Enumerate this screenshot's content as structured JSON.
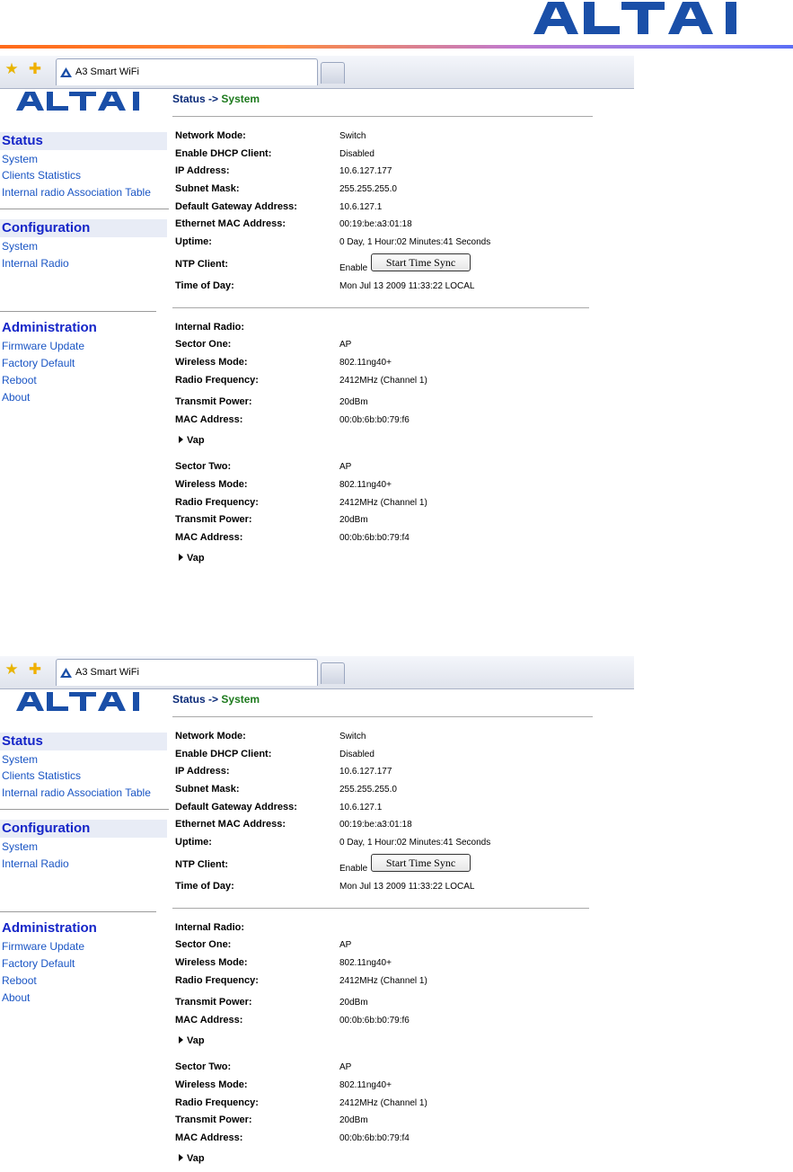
{
  "document": {
    "brand_logo": "ALTAI"
  },
  "screens": [
    {
      "browser": {
        "tab_title": "A3 Smart WiFi"
      },
      "brand": "ALTAI",
      "breadcrumb": {
        "section": "Status",
        "separator": "->",
        "page": "System"
      },
      "sidebar": {
        "status": {
          "title": "Status",
          "items": [
            "System",
            "Clients Statistics",
            "Internal radio Association Table"
          ]
        },
        "configuration": {
          "title": "Configuration",
          "items": [
            "System",
            "Internal Radio"
          ]
        },
        "administration": {
          "title": "Administration",
          "items": [
            "Firmware Update",
            "Factory Default",
            "Reboot",
            "About"
          ]
        }
      },
      "system": {
        "network_mode": {
          "label": "Network Mode:",
          "value": "Switch"
        },
        "dhcp_client": {
          "label": "Enable DHCP Client:",
          "value": "Disabled"
        },
        "ip_address": {
          "label": "IP Address:",
          "value": "10.6.127.177"
        },
        "subnet_mask": {
          "label": "Subnet Mask:",
          "value": "255.255.255.0"
        },
        "gateway": {
          "label": "Default Gateway Address:",
          "value": "10.6.127.1"
        },
        "ethernet_mac": {
          "label": "Ethernet MAC Address:",
          "value": "00:19:be:a3:01:18"
        },
        "uptime": {
          "label": "Uptime:",
          "value": "0 Day, 1 Hour:02 Minutes:41 Seconds"
        },
        "ntp_client": {
          "label": "NTP Client:",
          "value": "Enable",
          "button": "Start Time Sync"
        },
        "time_of_day": {
          "label": "Time of Day:",
          "value": "Mon Jul 13 2009 11:33:22 LOCAL"
        }
      },
      "radio": {
        "title": "Internal Radio:",
        "sector_one": {
          "sector": {
            "label": "Sector One:",
            "value": "AP"
          },
          "wireless_mode": {
            "label": "Wireless Mode:",
            "value": "802.11ng40+"
          },
          "frequency": {
            "label": "Radio Frequency:",
            "value": "2412MHz (Channel 1)"
          },
          "tx_power": {
            "label": "Transmit Power:",
            "value": "20dBm"
          },
          "mac": {
            "label": "MAC Address:",
            "value": "00:0b:6b:b0:79:f6"
          },
          "vap": "Vap"
        },
        "sector_two": {
          "sector": {
            "label": "Sector Two:",
            "value": "AP"
          },
          "wireless_mode": {
            "label": "Wireless Mode:",
            "value": "802.11ng40+"
          },
          "frequency": {
            "label": "Radio Frequency:",
            "value": "2412MHz (Channel 1)"
          },
          "tx_power": {
            "label": "Transmit Power:",
            "value": "20dBm"
          },
          "mac": {
            "label": "MAC Address:",
            "value": "00:0b:6b:b0:79:f4"
          },
          "vap": "Vap"
        }
      }
    },
    {
      "browser": {
        "tab_title": "A3 Smart WiFi"
      },
      "brand": "ALTAI",
      "breadcrumb": {
        "section": "Status",
        "separator": "->",
        "page": "System"
      },
      "sidebar": {
        "status": {
          "title": "Status",
          "items": [
            "System",
            "Clients Statistics",
            "Internal radio Association Table"
          ]
        },
        "configuration": {
          "title": "Configuration",
          "items": [
            "System",
            "Internal Radio"
          ]
        },
        "administration": {
          "title": "Administration",
          "items": [
            "Firmware Update",
            "Factory Default",
            "Reboot",
            "About"
          ]
        }
      },
      "system": {
        "network_mode": {
          "label": "Network Mode:",
          "value": "Switch"
        },
        "dhcp_client": {
          "label": "Enable DHCP Client:",
          "value": "Disabled"
        },
        "ip_address": {
          "label": "IP Address:",
          "value": "10.6.127.177"
        },
        "subnet_mask": {
          "label": "Subnet Mask:",
          "value": "255.255.255.0"
        },
        "gateway": {
          "label": "Default Gateway Address:",
          "value": "10.6.127.1"
        },
        "ethernet_mac": {
          "label": "Ethernet MAC Address:",
          "value": "00:19:be:a3:01:18"
        },
        "uptime": {
          "label": "Uptime:",
          "value": "0 Day, 1 Hour:02 Minutes:41 Seconds"
        },
        "ntp_client": {
          "label": "NTP Client:",
          "value": "Enable",
          "button": "Start Time Sync"
        },
        "time_of_day": {
          "label": "Time of Day:",
          "value": "Mon Jul 13 2009 11:33:22 LOCAL"
        }
      },
      "radio": {
        "title": "Internal Radio:",
        "sector_one": {
          "sector": {
            "label": "Sector One:",
            "value": "AP"
          },
          "wireless_mode": {
            "label": "Wireless Mode:",
            "value": "802.11ng40+"
          },
          "frequency": {
            "label": "Radio Frequency:",
            "value": "2412MHz (Channel 1)"
          },
          "tx_power": {
            "label": "Transmit Power:",
            "value": "20dBm"
          },
          "mac": {
            "label": "MAC Address:",
            "value": "00:0b:6b:b0:79:f6"
          },
          "vap": "Vap"
        },
        "sector_two": {
          "sector": {
            "label": "Sector Two:",
            "value": "AP"
          },
          "wireless_mode": {
            "label": "Wireless Mode:",
            "value": "802.11ng40+"
          },
          "frequency": {
            "label": "Radio Frequency:",
            "value": "2412MHz (Channel 1)"
          },
          "tx_power": {
            "label": "Transmit Power:",
            "value": "20dBm"
          },
          "mac": {
            "label": "MAC Address:",
            "value": "00:0b:6b:b0:79:f4"
          },
          "vap": "Vap"
        }
      }
    }
  ]
}
